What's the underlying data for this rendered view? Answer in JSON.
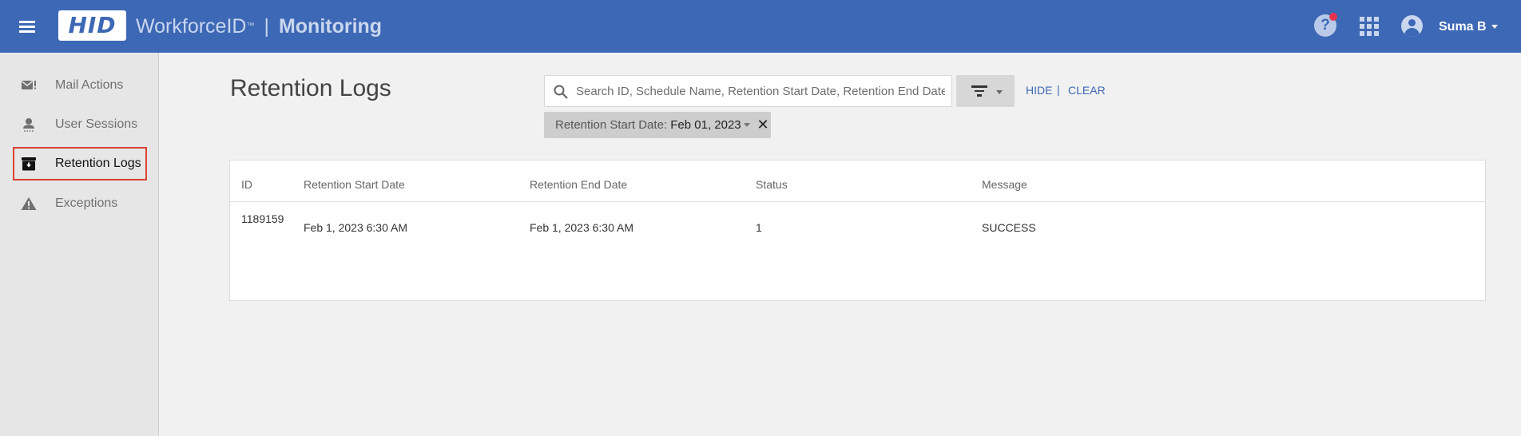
{
  "header": {
    "logo_text": "HID",
    "product": "WorkforceID",
    "trademark": "™",
    "separator": "|",
    "module": "Monitoring",
    "user_name": "Suma B",
    "brand_color": "#3d68b5",
    "notification_color": "#e8344f"
  },
  "sidebar": {
    "items": [
      {
        "label": "Mail Actions",
        "icon": "mail-alert-icon",
        "active": false
      },
      {
        "label": "User Sessions",
        "icon": "user-session-icon",
        "active": false
      },
      {
        "label": "Retention Logs",
        "icon": "archive-icon",
        "active": true
      },
      {
        "label": "Exceptions",
        "icon": "warning-icon",
        "active": false
      }
    ]
  },
  "main": {
    "title": "Retention Logs",
    "search": {
      "placeholder": "Search ID, Schedule Name, Retention Start Date, Retention End Date, Message",
      "value": ""
    },
    "hide_label": "HIDE",
    "link_separator": "|",
    "clear_label": "CLEAR",
    "filter_chip": {
      "label": "Retention Start Date:",
      "value": "Feb 01, 2023",
      "close_symbol": "✕"
    },
    "table": {
      "columns": [
        "ID",
        "Retention Start Date",
        "Retention End Date",
        "Status",
        "Message"
      ],
      "rows": [
        {
          "id": "1189159",
          "start": "Feb 1, 2023 6:30 AM",
          "end": "Feb 1, 2023 6:30 AM",
          "status": "1",
          "message": "SUCCESS"
        }
      ]
    }
  }
}
